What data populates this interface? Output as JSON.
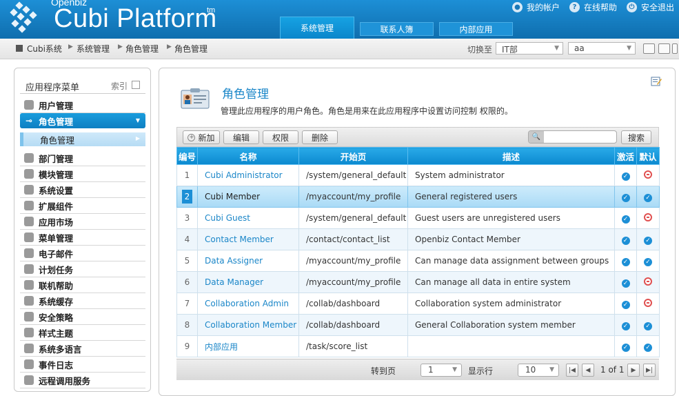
{
  "header": {
    "logo_sub": "Openbiz",
    "logo_main": "Cubi Platform",
    "logo_tm": "tm",
    "links": [
      {
        "label": "我的帐户",
        "icon": "user-icon"
      },
      {
        "label": "在线帮助",
        "icon": "help-icon"
      },
      {
        "label": "安全退出",
        "icon": "power-icon"
      }
    ],
    "tabs": [
      {
        "label": "系统管理",
        "active": true
      },
      {
        "label": "联系人簿",
        "active": false
      },
      {
        "label": "内部应用",
        "active": false
      }
    ]
  },
  "breadcrumb": {
    "items": [
      "Cubi系统",
      "系统管理",
      "角色管理",
      "角色管理"
    ],
    "switch_label": "切换至",
    "dept_select": "IT部",
    "user_select": "aa"
  },
  "sidebar": {
    "title": "应用程序菜单",
    "index_label": "索引",
    "items": [
      {
        "label": "用户管理",
        "icon": "user-icon"
      },
      {
        "label": "角色管理",
        "icon": "key-icon",
        "active": true
      },
      {
        "label": "部门管理",
        "icon": "group-icon"
      },
      {
        "label": "模块管理",
        "icon": "module-icon"
      },
      {
        "label": "系统设置",
        "icon": "gear-icon"
      },
      {
        "label": "扩展组件",
        "icon": "puzzle-icon"
      },
      {
        "label": "应用市场",
        "icon": "market-icon"
      },
      {
        "label": "菜单管理",
        "icon": "menu-icon"
      },
      {
        "label": "电子邮件",
        "icon": "mail-icon"
      },
      {
        "label": "计划任务",
        "icon": "clock-icon"
      },
      {
        "label": "联机帮助",
        "icon": "help-icon"
      },
      {
        "label": "系统缓存",
        "icon": "lightning-icon"
      },
      {
        "label": "安全策略",
        "icon": "shield-icon"
      },
      {
        "label": "样式主题",
        "icon": "theme-icon"
      },
      {
        "label": "系统多语言",
        "icon": "language-icon"
      },
      {
        "label": "事件日志",
        "icon": "log-icon"
      },
      {
        "label": "远程调用服务",
        "icon": "globe-icon"
      }
    ],
    "subitem": "角色管理"
  },
  "main": {
    "title": "角色管理",
    "description": "管理此应用程序的用户角色。角色是用来在此应用程序中设置访问控制 权限的。",
    "buttons": {
      "new": "新加",
      "edit": "编辑",
      "perm": "权限",
      "delete": "删除",
      "search": "搜索"
    },
    "search_value": "",
    "columns": [
      "编号",
      "名称",
      "开始页",
      "描述",
      "激活",
      "默认"
    ],
    "rows": [
      {
        "num": "1",
        "name": "Cubi Administrator",
        "start": "/system/general_default",
        "desc": "System administrator",
        "active": true,
        "default": false
      },
      {
        "num": "2",
        "name": "Cubi Member",
        "start": "/myaccount/my_profile",
        "desc": "General registered users",
        "active": true,
        "default": true,
        "selected": true
      },
      {
        "num": "3",
        "name": "Cubi Guest",
        "start": "/system/general_default",
        "desc": "Guest users are unregistered users",
        "active": true,
        "default": false
      },
      {
        "num": "4",
        "name": "Contact Member",
        "start": "/contact/contact_list",
        "desc": "Openbiz Contact Member",
        "active": true,
        "default": true
      },
      {
        "num": "5",
        "name": "Data Assigner",
        "start": "/myaccount/my_profile",
        "desc": "Can manage data assignment between groups",
        "active": true,
        "default": true
      },
      {
        "num": "6",
        "name": "Data Manager",
        "start": "/myaccount/my_profile",
        "desc": "Can manage all data in entire system",
        "active": true,
        "default": false
      },
      {
        "num": "7",
        "name": "Collaboration Admin",
        "start": "/collab/dashboard",
        "desc": "Collaboration system administrator",
        "active": true,
        "default": false
      },
      {
        "num": "8",
        "name": "Collaboration Member",
        "start": "/collab/dashboard",
        "desc": "General Collaboration system member",
        "active": true,
        "default": true
      },
      {
        "num": "9",
        "name": "内部应用",
        "start": "/task/score_list",
        "desc": "",
        "active": true,
        "default": true
      }
    ],
    "pager": {
      "goto_label": "转到页",
      "page": "1",
      "rows_label": "显示行",
      "rows_per_page": "10",
      "page_info": "1 of 1"
    }
  },
  "colors": {
    "accent": "#1a86c8",
    "header": "#1281c5",
    "grid_header": "#149ad9"
  }
}
